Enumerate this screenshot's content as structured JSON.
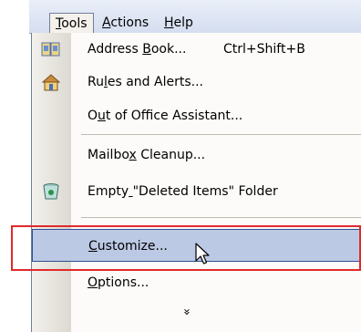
{
  "menubar": {
    "items": [
      {
        "label": "Tools",
        "accel": "T",
        "rest": "ools"
      },
      {
        "label": "Actions",
        "accel": "A",
        "rest": "ctions"
      },
      {
        "label": "Help",
        "accel": "H",
        "rest": "elp"
      }
    ]
  },
  "menu": {
    "items": [
      {
        "pre": "Address ",
        "accel": "B",
        "post": "ook...",
        "shortcut": "Ctrl+Shift+B",
        "icon": "address-book-icon"
      },
      {
        "pre": "Ru",
        "accel": "l",
        "post": "es and Alerts...",
        "icon": "rules-alerts-icon"
      },
      {
        "pre": "O",
        "accel": "u",
        "post": "t of Office Assistant..."
      },
      {
        "pre": "Mailbo",
        "accel": "x",
        "post": " Cleanup..."
      },
      {
        "pre": "Empty",
        "accel": " ",
        "post": "\"Deleted Items\" Folder",
        "icon": "recycle-bin-icon"
      },
      {
        "pre": "",
        "accel": "C",
        "post": "ustomize..."
      },
      {
        "pre": "",
        "accel": "O",
        "post": "ptions..."
      }
    ],
    "expand_glyph": "»",
    "colors": {
      "highlight": "#bcc9e4",
      "callout": "#e02a2a"
    }
  }
}
